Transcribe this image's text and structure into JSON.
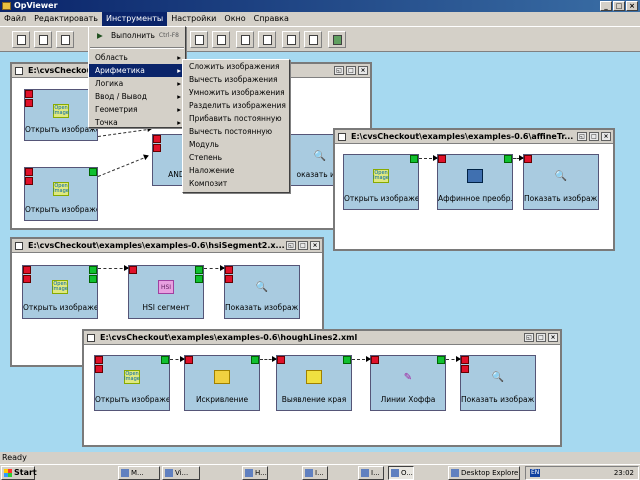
{
  "app": {
    "title": "OpViewer"
  },
  "menu": [
    "Файл",
    "Редактировать",
    "Инструменты",
    "Настройки",
    "Окно",
    "Справка"
  ],
  "tools_menu": {
    "execute": {
      "label": "Выполнить",
      "shortcut": "Ctrl-F8"
    },
    "items": [
      "Область",
      "Арифметика",
      "Логика",
      "Ввод / Вывод",
      "Геометрия",
      "Точка"
    ]
  },
  "arith_menu": [
    "Сложить изображения",
    "Вычесть изображения",
    "Умножить изображения",
    "Разделить изображения",
    "Прибавить постоянную",
    "Вычесть постоянную",
    "Модуль",
    "Степень",
    "Наложение",
    "Композит"
  ],
  "frames": {
    "w1": {
      "title": "E:\\cvsCheckout",
      "nodes": [
        "Открыть изображе...",
        "Открыть изображе...",
        "AND из",
        "оказать изо"
      ]
    },
    "w2": {
      "title": "E:\\cvsCheckout\\examples\\examples-0.6\\affineTr...",
      "nodes": [
        "Открыть изображе...",
        "Аффинное преобр...",
        "Показать изображ..."
      ]
    },
    "w3": {
      "title": "E:\\cvsCheckout\\examples\\examples-0.6\\hsiSegment2.x...",
      "nodes": [
        "Открыть изображе...",
        "HSI сегмент",
        "Показать изображ..."
      ]
    },
    "w4": {
      "title": "E:\\cvsCheckout\\examples\\examples-0.6\\houghLines2.xml",
      "nodes": [
        "Открыть изображе...",
        "Искривление",
        "Выявление края",
        "Линии Хоффа",
        "Показать изображ..."
      ]
    }
  },
  "status": "Ready",
  "taskbar": {
    "start": "Start",
    "items": [
      "M...",
      "Vi...",
      "H...",
      "I...",
      "I...",
      "O...",
      "Desktop Explorer"
    ],
    "lang": "EN",
    "clock": "23:02"
  }
}
